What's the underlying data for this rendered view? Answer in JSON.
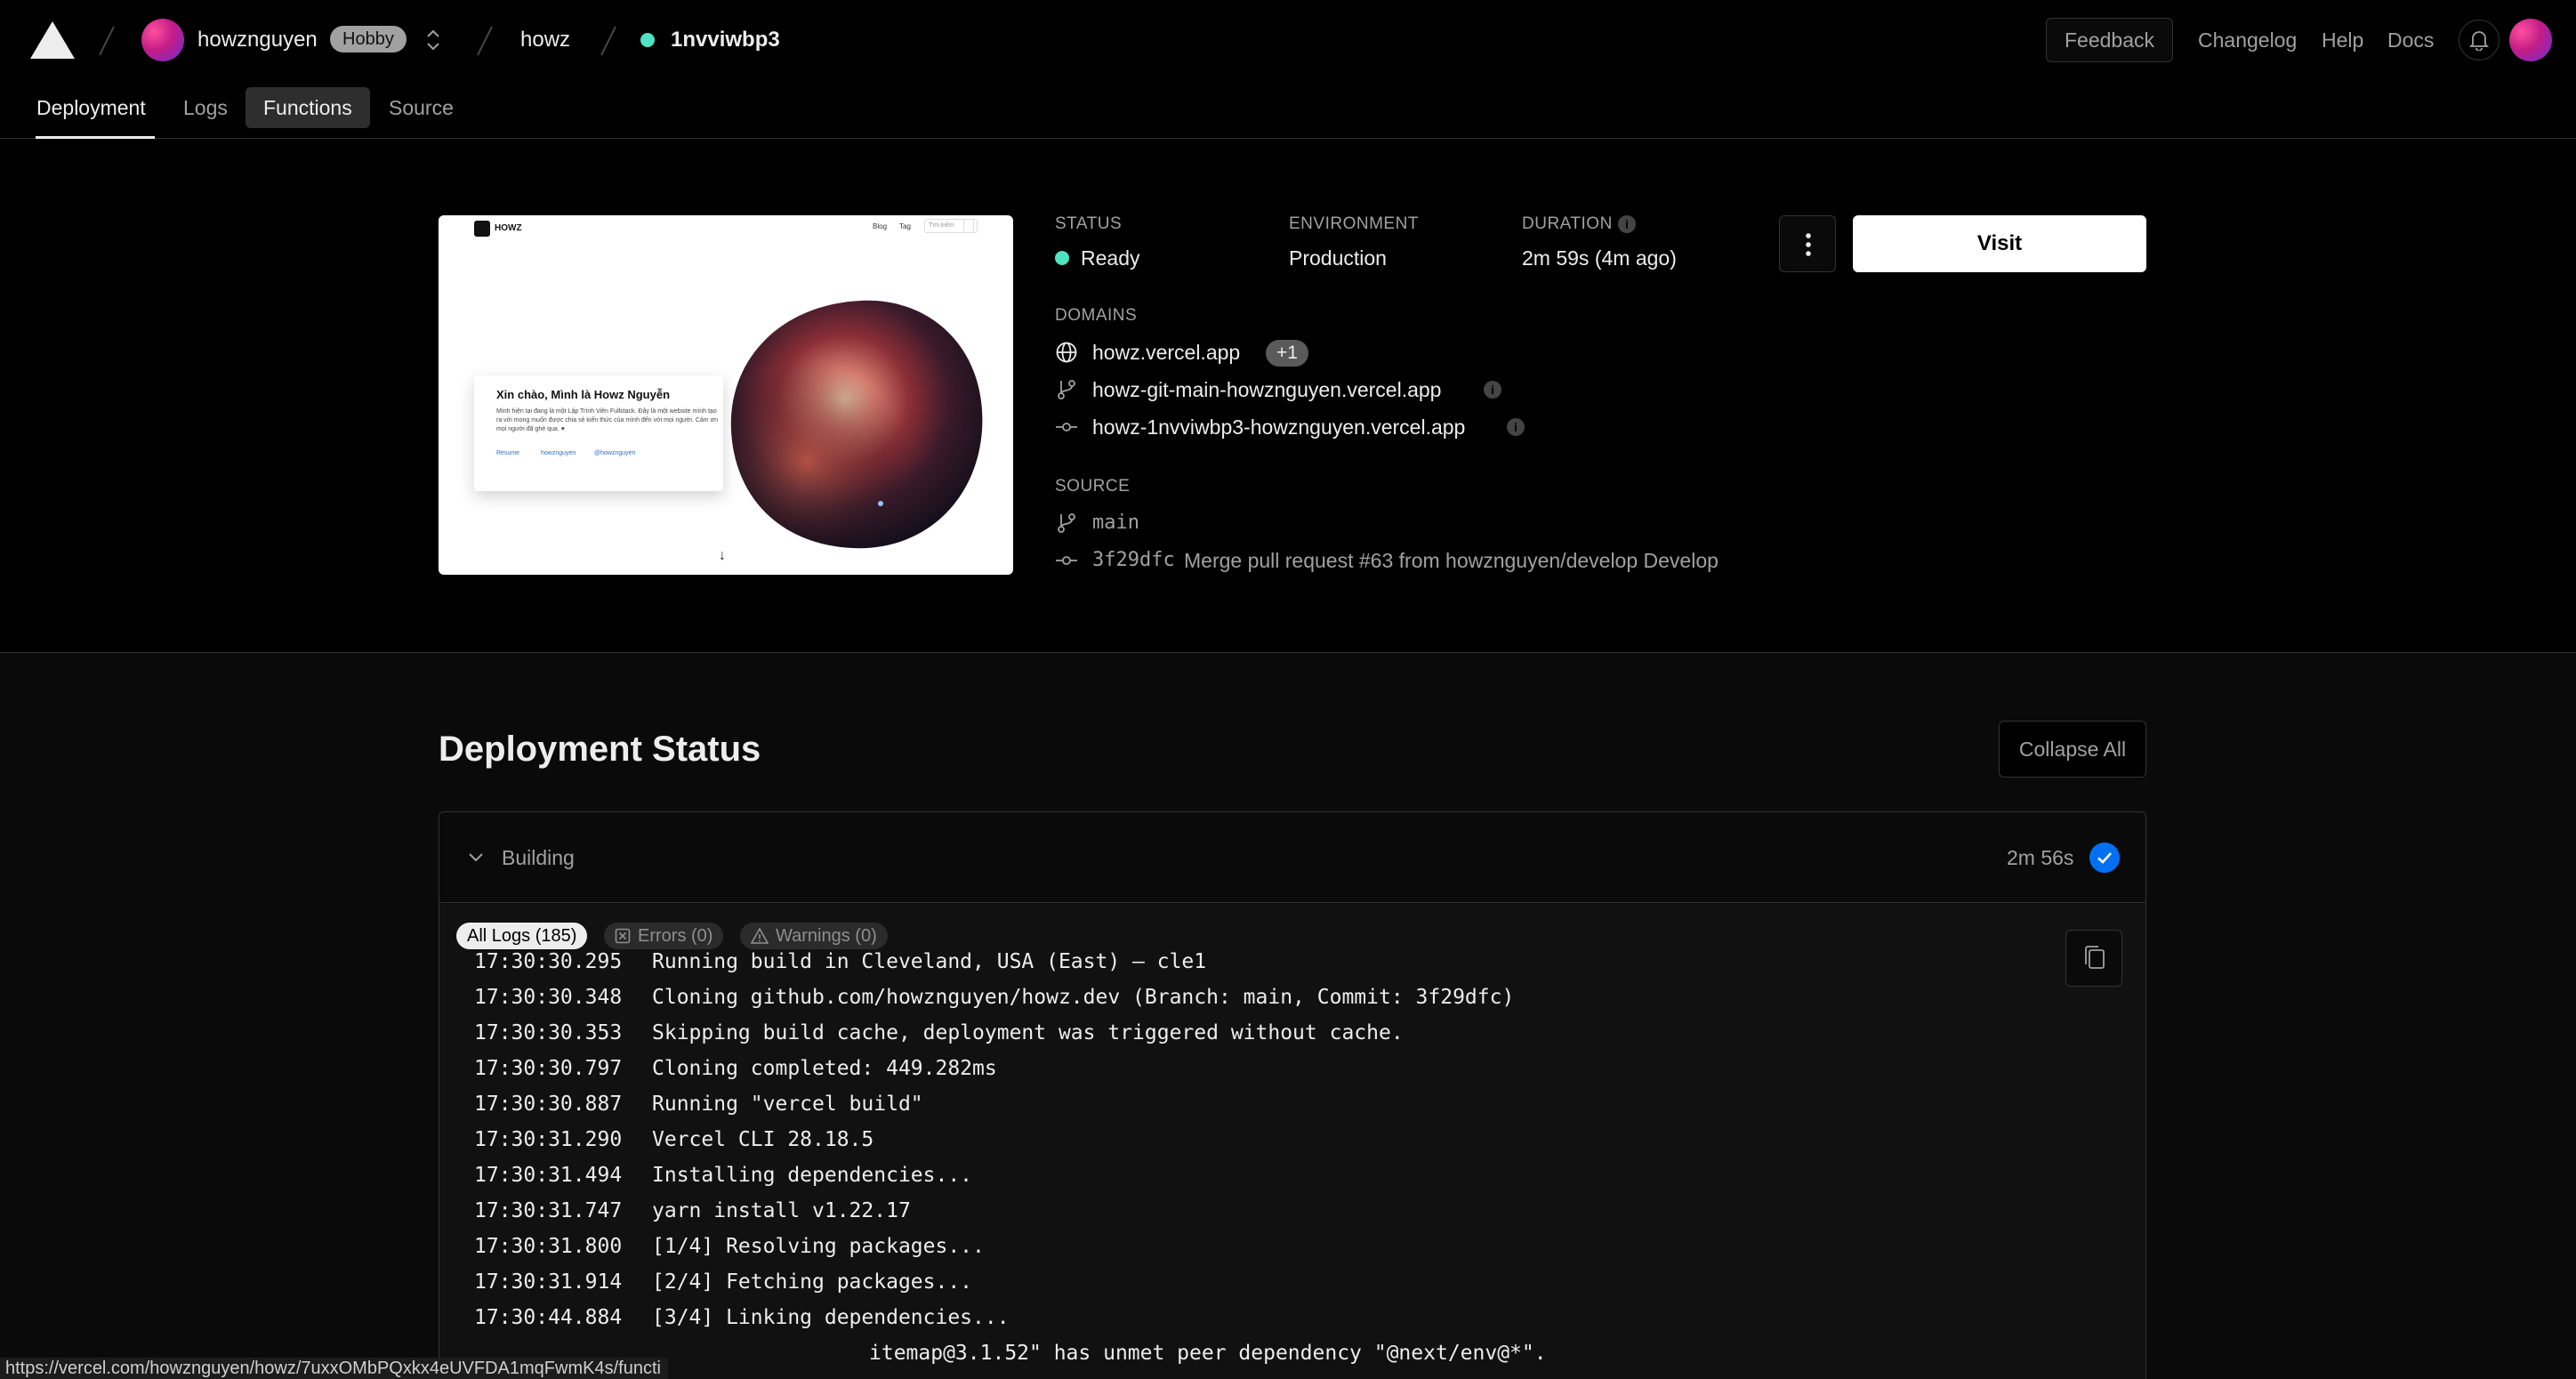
{
  "header": {
    "team": "howznguyen",
    "plan_badge": "Hobby",
    "project": "howz",
    "deployment": "1nvviwbp3",
    "feedback": "Feedback",
    "links": [
      "Changelog",
      "Help",
      "Docs"
    ]
  },
  "tabs": [
    "Deployment",
    "Logs",
    "Functions",
    "Source"
  ],
  "preview": {
    "brand": "HOWZ",
    "nav": [
      "Blog",
      "Tag",
      "Tìm kiếm"
    ],
    "headline": "Xin chào, Mình là Howz Nguyễn",
    "body": "Mình hiện tại đang là một Lập Trình Viên Fullstack. Đây là một website mình tạo ra với mong muốn được chia sẻ kiến thức của mình đến với mọi người. Cảm ơn mọi người đã ghé qua. ♥",
    "links": [
      "Resume",
      "howznguyen",
      "@howznguyen"
    ],
    "scroll_glyph": "↓"
  },
  "summary": {
    "status_label": "STATUS",
    "status_value": "Ready",
    "env_label": "ENVIRONMENT",
    "env_value": "Production",
    "duration_label": "DURATION",
    "duration_value": "2m 59s (4m ago)",
    "domains_label": "DOMAINS",
    "domains": [
      "howz.vercel.app",
      "howz-git-main-howznguyen.vercel.app",
      "howz-1nvviwbp3-howznguyen.vercel.app"
    ],
    "domains_more": "+1",
    "source_label": "SOURCE",
    "branch": "main",
    "commit_hash": "3f29dfc",
    "commit_message": "Merge pull request #63 from howznguyen/develop Develop",
    "visit": "Visit"
  },
  "status_section": {
    "title": "Deployment Status",
    "collapse": "Collapse All",
    "step_title": "Building",
    "step_duration": "2m 56s",
    "filters": [
      "All Logs (185)",
      "Errors (0)",
      "Warnings (0)"
    ],
    "logs": [
      {
        "time": "17:30:30.295",
        "text": "Running build in Cleveland, USA (East) – cle1"
      },
      {
        "time": "17:30:30.348",
        "text": "Cloning github.com/howznguyen/howz.dev (Branch: main, Commit: 3f29dfc)"
      },
      {
        "time": "17:30:30.353",
        "text": "Skipping build cache, deployment was triggered without cache."
      },
      {
        "time": "17:30:30.797",
        "text": "Cloning completed: 449.282ms"
      },
      {
        "time": "17:30:30.887",
        "text": "Running \"vercel build\""
      },
      {
        "time": "17:30:31.290",
        "text": "Vercel CLI 28.18.5"
      },
      {
        "time": "17:30:31.494",
        "text": "Installing dependencies..."
      },
      {
        "time": "17:30:31.747",
        "text": "yarn install v1.22.17"
      },
      {
        "time": "17:30:31.800",
        "text": "[1/4] Resolving packages..."
      },
      {
        "time": "17:30:31.914",
        "text": "[2/4] Fetching packages..."
      },
      {
        "time": "17:30:44.884",
        "text": "[3/4] Linking dependencies..."
      },
      {
        "time": "",
        "text": "itemap@3.1.52\" has unmet peer dependency \"@next/env@*\"."
      }
    ]
  },
  "status_bar_url": "https://vercel.com/howznguyen/howz/7uxxOMbPQxkx4eUVFDA1mqFwmK4s/functi",
  "colors": {
    "ready": "#50e3c2",
    "accent_blue": "#0070f3",
    "background": "#000000"
  }
}
